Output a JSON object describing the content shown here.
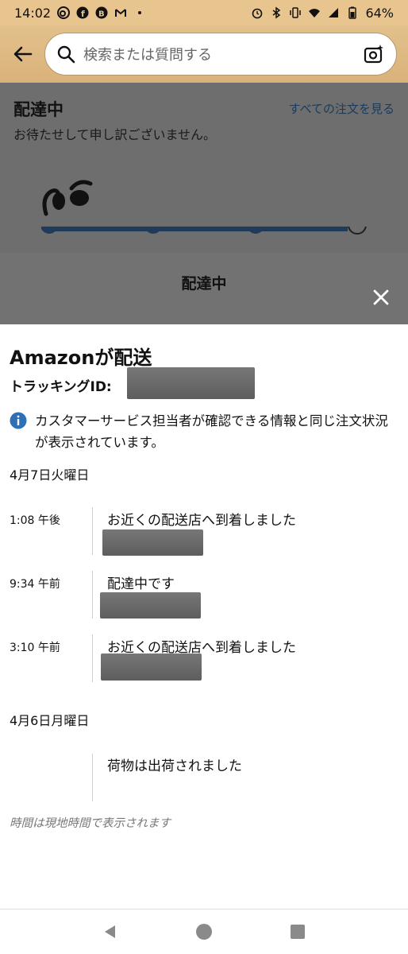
{
  "status_bar": {
    "time": "14:02",
    "battery": "64%",
    "left_icons": [
      "d-app-icon",
      "facebook-icon",
      "b-app-icon",
      "gmail-icon",
      "dot-icon"
    ],
    "right_icons": [
      "alarm-icon",
      "bluetooth-icon",
      "vibrate-icon",
      "wifi-icon",
      "signal-icon",
      "battery-icon"
    ]
  },
  "search": {
    "placeholder": "検索または質問する"
  },
  "background_page": {
    "title": "配達中",
    "subtitle": "お待たせして申し訳ございません。",
    "all_orders_link": "すべての注文を見る",
    "status_heading": "配達中",
    "progress": {
      "completed_steps": 3,
      "total_steps": 4
    }
  },
  "sheet": {
    "title": "Amazonが配送",
    "tracking_label": "トラッキングID:",
    "info_text": "カスタマーサービス担当者が確認できる情報と同じ注文状況が表示されています。",
    "days": [
      {
        "date": "4月7日火曜日",
        "events": [
          {
            "time": "1:08 午後",
            "text": "お近くの配送店へ到着しました"
          },
          {
            "time": "9:34 午前",
            "text": "配達中です"
          },
          {
            "time": "3:10 午前",
            "text": "お近くの配送店へ到着しました"
          }
        ]
      },
      {
        "date": "4月6日月曜日",
        "events": [
          {
            "time": "",
            "text": "荷物は出荷されました"
          }
        ]
      }
    ],
    "footnote": "時間は現地時間で表示されます"
  },
  "colors": {
    "header": "#e3c18c",
    "overlay": "#6e6e6e",
    "progress": "#1f3a5a",
    "info_icon": "#2f6fb5"
  }
}
